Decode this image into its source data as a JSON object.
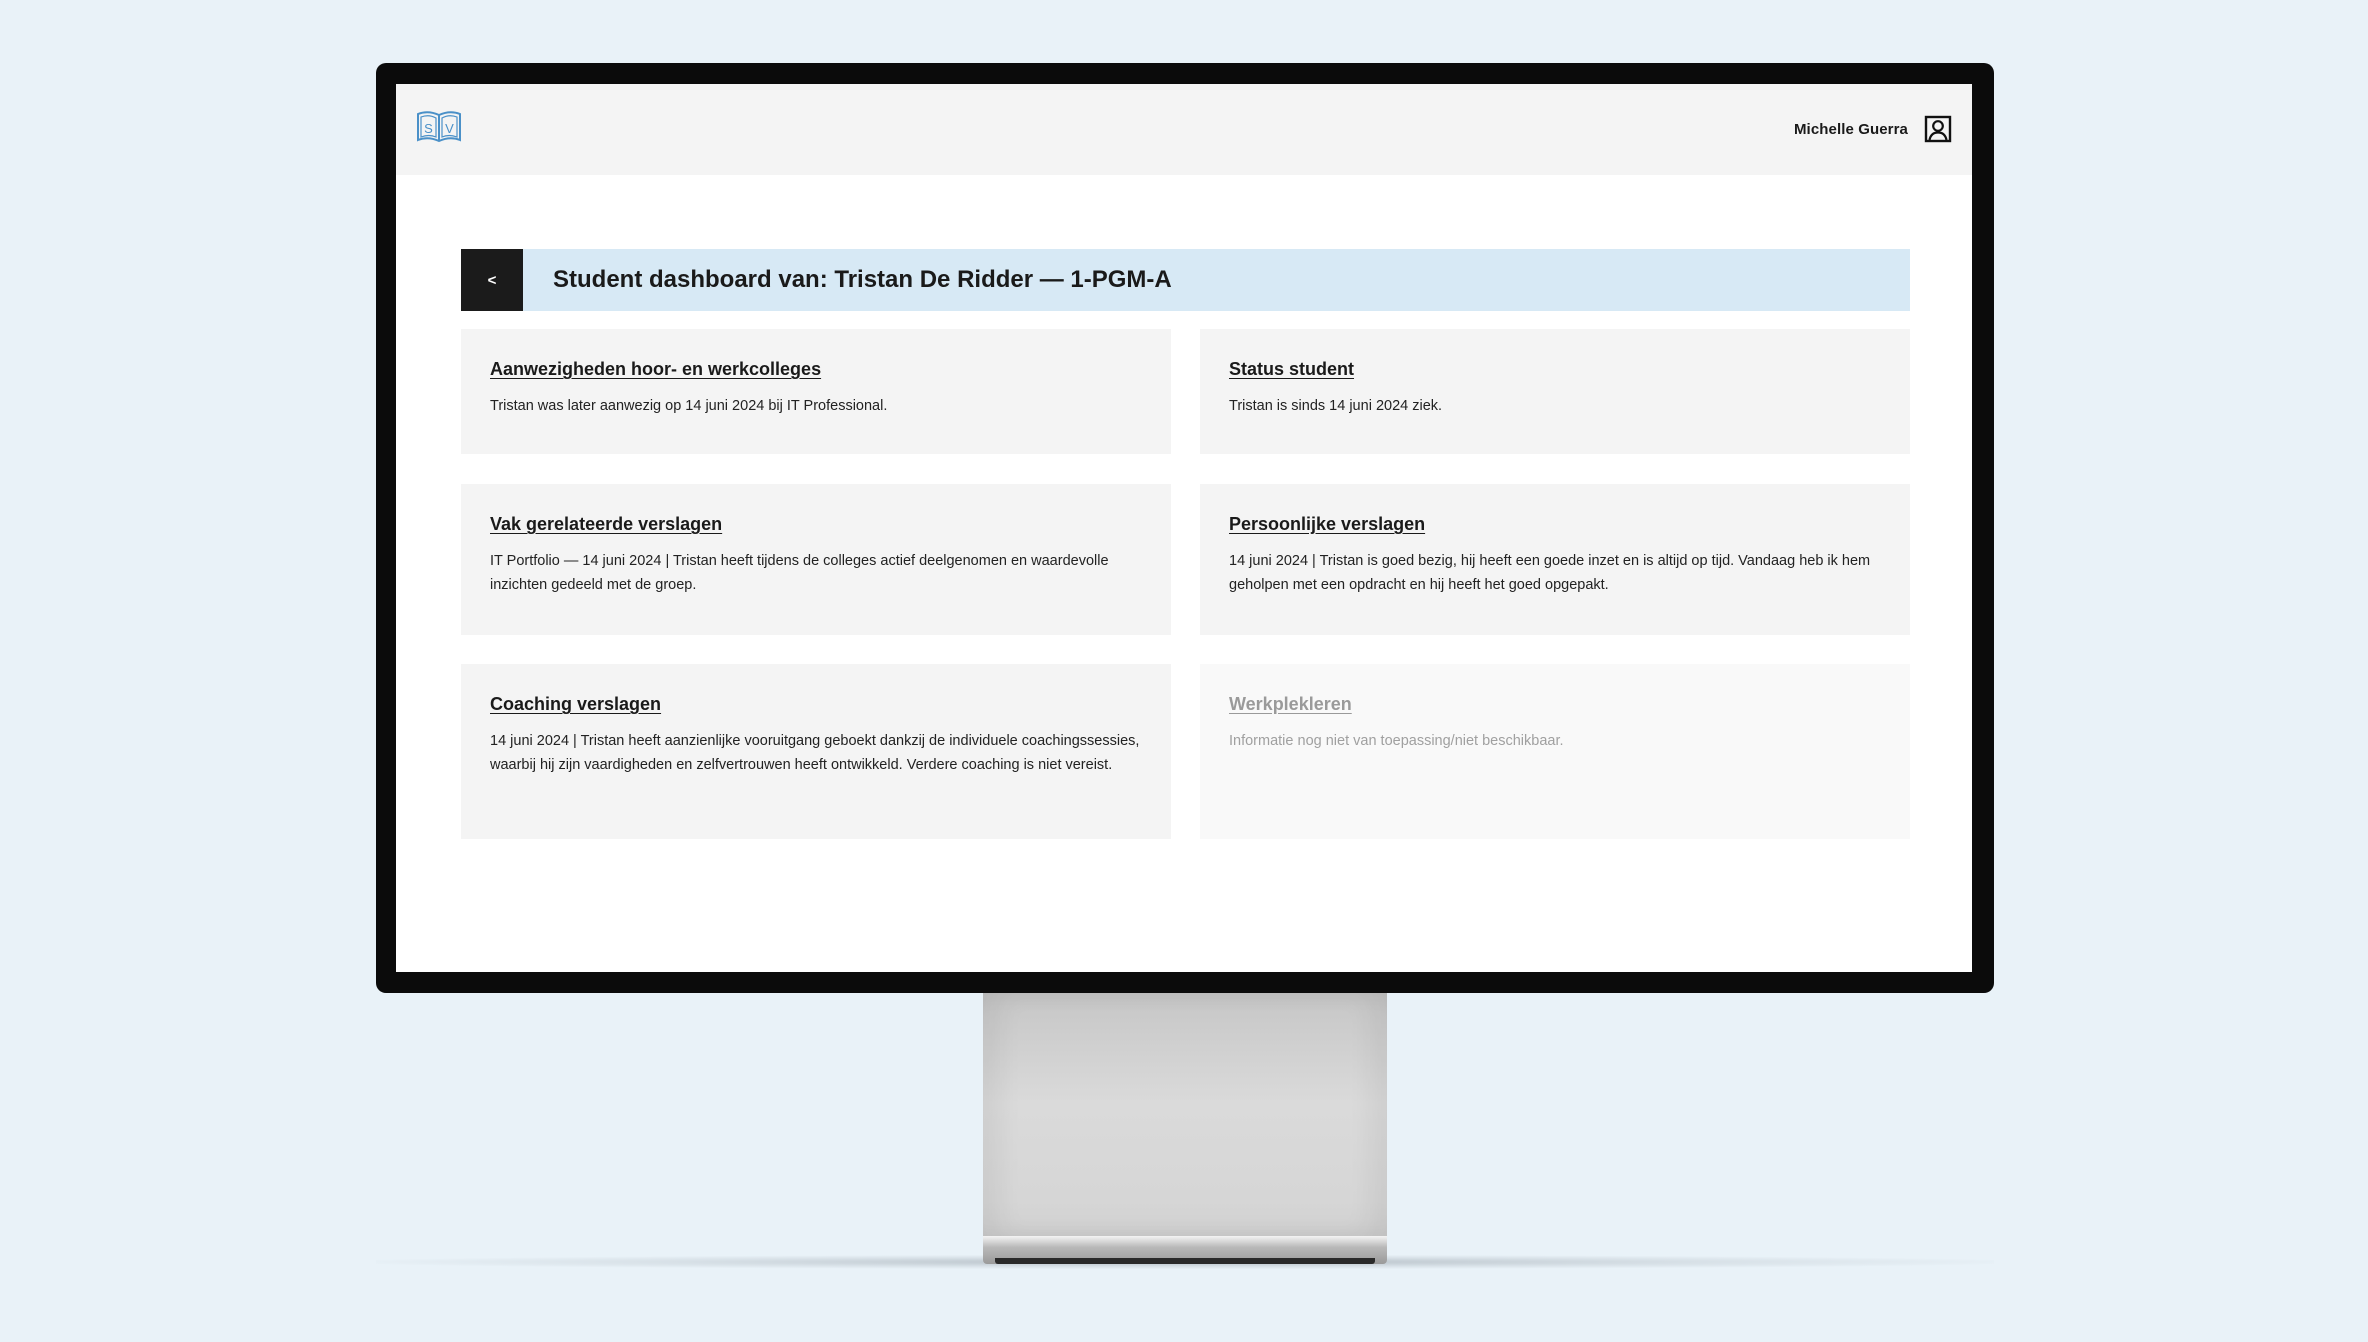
{
  "header": {
    "logo_letters": "SV",
    "user_name": "Michelle Guerra"
  },
  "title_bar": {
    "back_label": "<",
    "title": "Student dashboard van: Tristan De Ridder — 1-PGM-A"
  },
  "cards": [
    {
      "title": "Aanwezigheden hoor- en werkcolleges",
      "text": "Tristan was later aanwezig op 14 juni 2024 bij IT Professional.",
      "available": true
    },
    {
      "title": "Status student",
      "text": "Tristan is sinds 14 juni 2024 ziek.",
      "available": true
    },
    {
      "title": "Vak gerelateerde verslagen",
      "text": "IT Portfolio — 14 juni 2024 | Tristan heeft tijdens de colleges actief deelgenomen en waardevolle inzichten gedeeld met de groep.",
      "available": true
    },
    {
      "title": "Persoonlijke verslagen",
      "text": "14 juni 2024 | Tristan is goed bezig, hij heeft een goede inzet en is altijd op tijd. Vandaag heb ik hem geholpen met een opdracht en hij heeft het goed opgepakt.",
      "available": true
    },
    {
      "title": "Coaching verslagen",
      "text": "14 juni 2024 | Tristan heeft aanzienlijke vooruitgang geboekt dankzij de individuele coachingssessies, waarbij hij zijn vaardigheden en zelfvertrouwen heeft ontwikkeld. Verdere coaching is niet vereist.",
      "available": true
    },
    {
      "title": "Werkplekleren",
      "text": "Informatie nog niet van toepassing/niet beschikbaar.",
      "available": false
    }
  ],
  "colors": {
    "background": "#e9f2f8",
    "title_bar": "#d7e9f5",
    "card": "#f4f4f4",
    "logo_blue": "#4a90c8",
    "back_button": "#1b1b1b"
  },
  "icons": {
    "logo": "open-book-icon",
    "user": "user-profile-icon"
  }
}
